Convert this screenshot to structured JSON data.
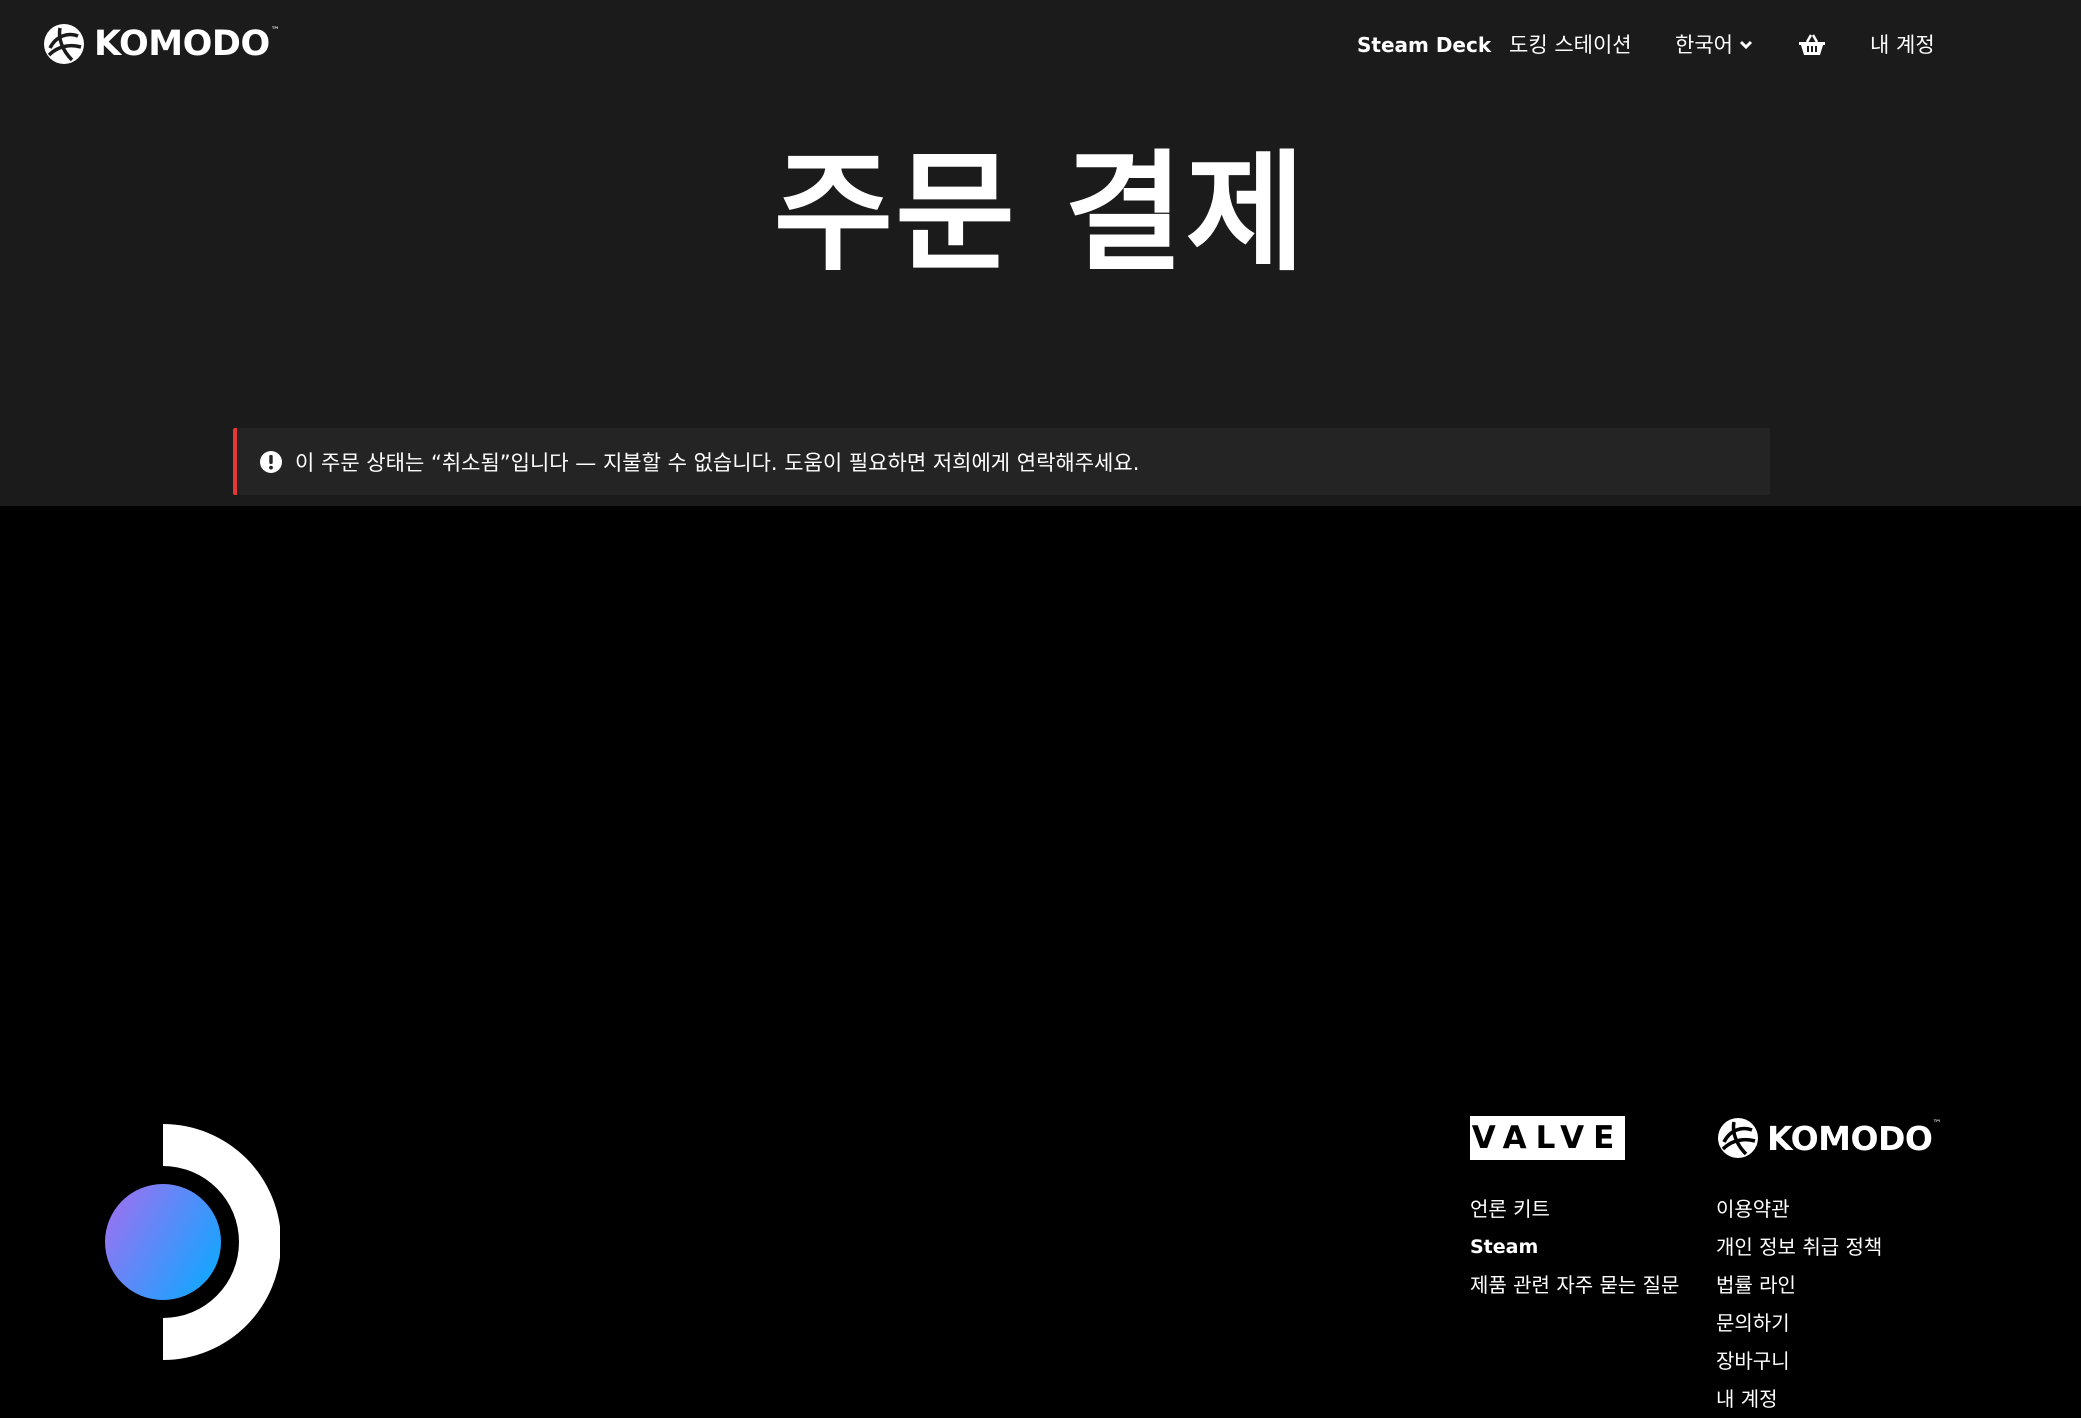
{
  "header": {
    "brand": "KOMODO",
    "brand_tm": "™",
    "nav": {
      "steam_deck": "Steam Deck",
      "docking_station": "도킹 스테이션",
      "language": "한국어",
      "cart_icon": "basket-icon",
      "account": "내 계정"
    }
  },
  "main": {
    "title": "주문 결제",
    "alert": {
      "icon": "exclamation-circle-icon",
      "message": "이 주문 상태는 “취소됨”입니다 — 지불할 수 없습니다. 도움이 필요하면 저희에게 연락해주세요.",
      "accent_color": "#e53935"
    }
  },
  "footer": {
    "steam_logo_icon": "steam-deck-logo-icon",
    "valve": {
      "logo": "VALVE",
      "logo_r": "®",
      "links": [
        "언론 키트",
        "Steam",
        "제품 관련 자주 묻는 질문"
      ]
    },
    "komodo": {
      "logo": "KOMODO",
      "logo_tm": "™",
      "links": [
        "이용약관",
        "개인 정보 취급 정책",
        "법률 라인",
        "문의하기",
        "장바구니",
        "내 계정"
      ]
    }
  },
  "colors": {
    "top_background": "#1b1b1b",
    "footer_background": "#000000",
    "alert_background": "#242424",
    "gradient_start": "#a76df0",
    "gradient_end": "#1aa3ff"
  }
}
